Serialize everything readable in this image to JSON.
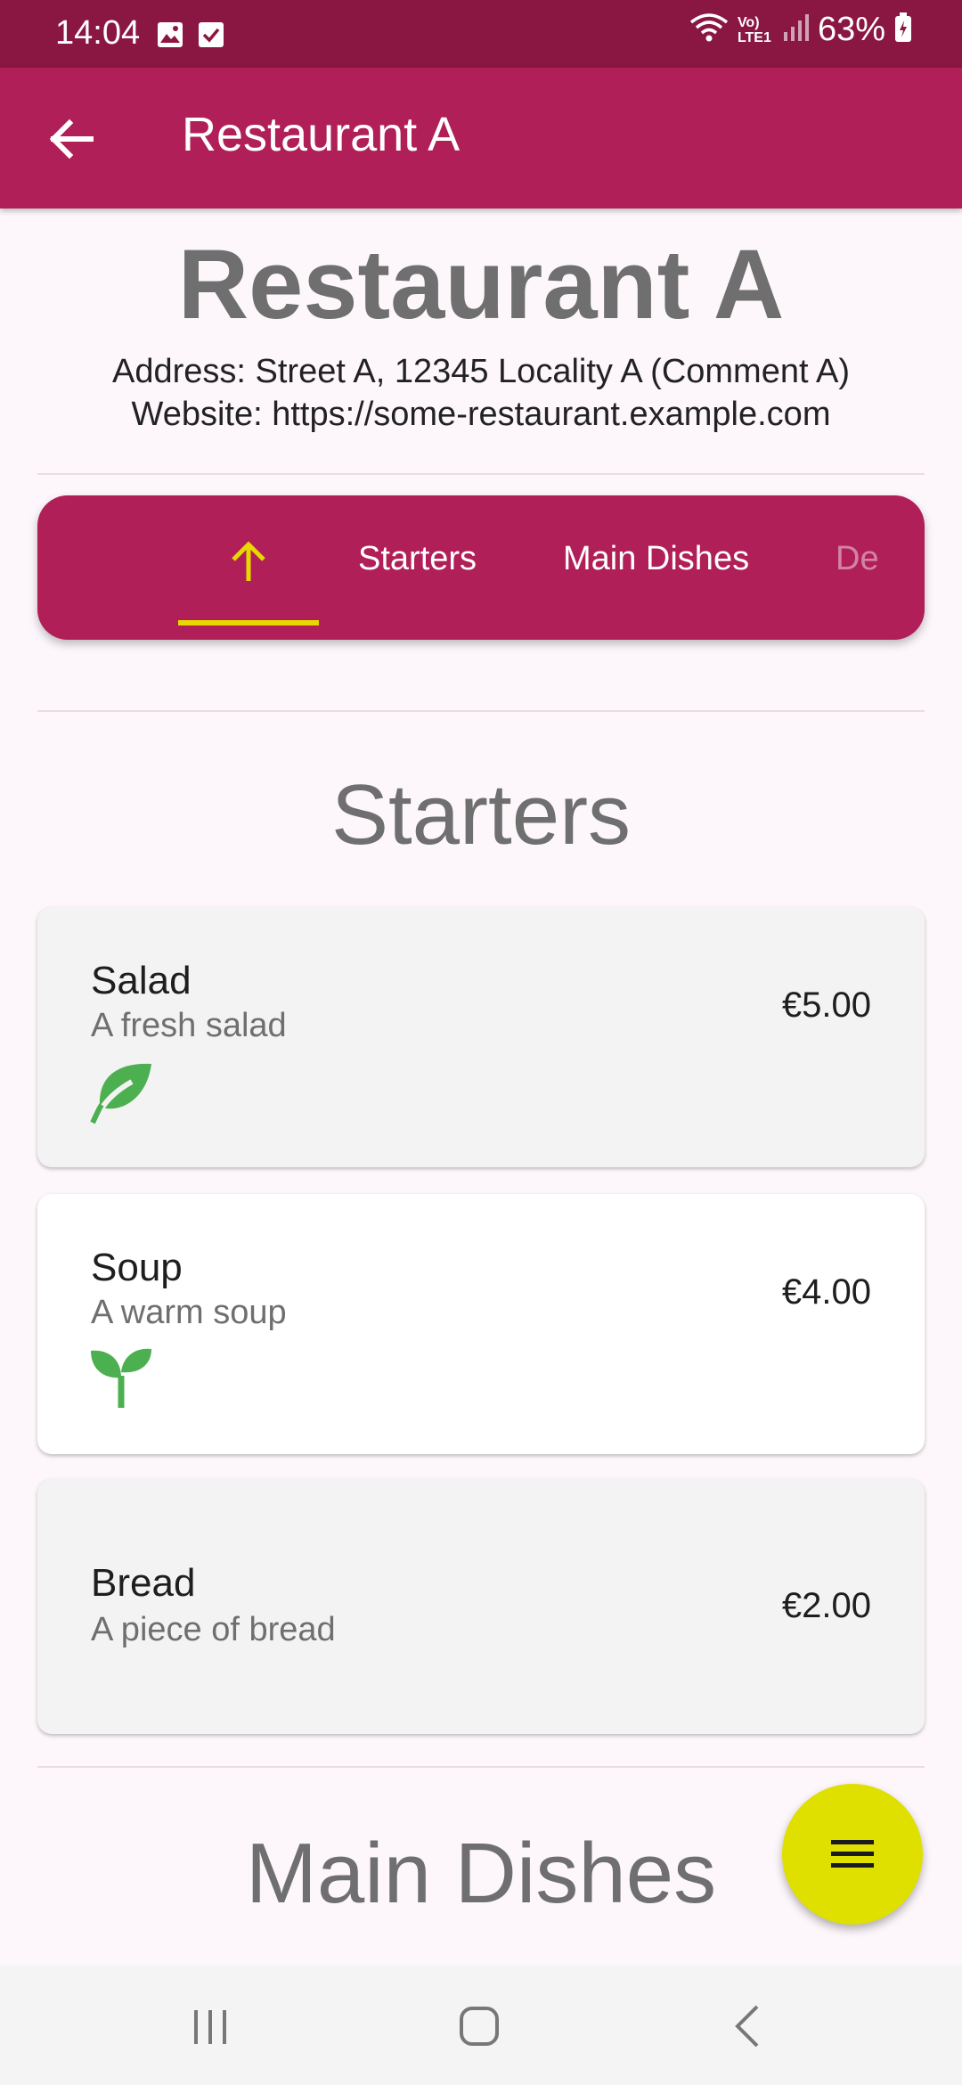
{
  "status_bar": {
    "time": "14:04",
    "battery_percent": "63%",
    "network_label": "Vo) LTE1",
    "icons": [
      "image-icon",
      "check-icon",
      "wifi-icon",
      "signal-icon",
      "battery-icon"
    ]
  },
  "app_bar": {
    "title": "Restaurant A",
    "back_icon": "arrow-left-icon"
  },
  "restaurant": {
    "name": "Restaurant A",
    "address": "Address: Street A, 12345 Locality A (Comment A)",
    "website": "Website: https://some-restaurant.example.com"
  },
  "tabs": {
    "items": [
      {
        "label": "",
        "icon": "arrow-up-icon",
        "selected": true
      },
      {
        "label": "Starters",
        "selected": false
      },
      {
        "label": "Main Dishes",
        "selected": false
      },
      {
        "label": "De",
        "selected": false
      }
    ],
    "indicator_color": "#e6d800"
  },
  "sections": [
    {
      "title": "Starters",
      "dishes": [
        {
          "name": "Salad",
          "description": "A fresh salad",
          "price": "€5.00",
          "icon": "leaf-icon"
        },
        {
          "name": "Soup",
          "description": "A warm soup",
          "price": "€4.00",
          "icon": "sprout-icon"
        },
        {
          "name": "Bread",
          "description": "A piece of bread",
          "price": "€2.00",
          "icon": ""
        }
      ]
    },
    {
      "title": "Main Dishes",
      "dishes": []
    }
  ],
  "fab": {
    "icon": "menu-icon",
    "color": "#dfdf00"
  },
  "nav_bar": {
    "icons": [
      "recent-apps-icon",
      "home-icon",
      "back-icon"
    ]
  },
  "colors": {
    "primary": "#b01f57",
    "primary_dark": "#8a1741",
    "accent": "#e6d800",
    "veg_green": "#4caf50"
  }
}
